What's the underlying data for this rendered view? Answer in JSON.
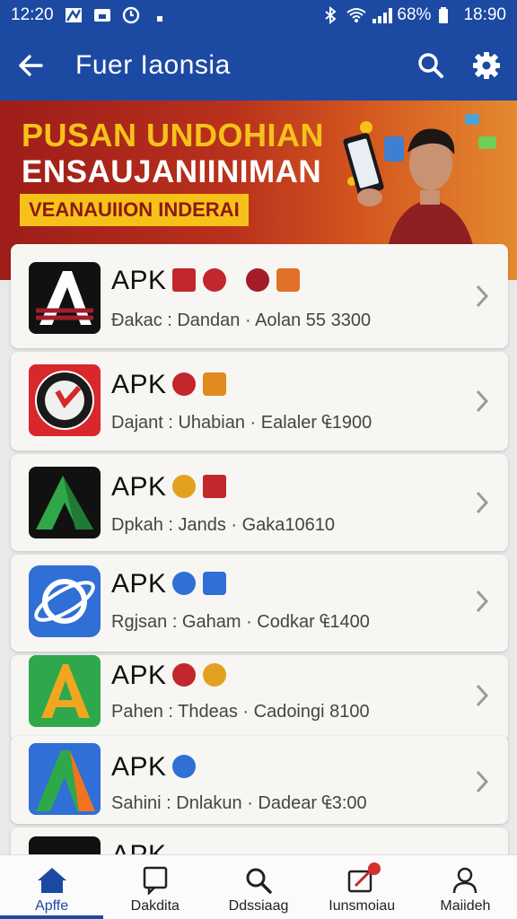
{
  "status": {
    "time": "12:20",
    "battery": "68%",
    "clock": "18:90"
  },
  "appbar": {
    "title": "Fuer Iaonsia"
  },
  "banner": {
    "line1": "PUSAN UNDOHIAN",
    "line2": "ENSAUJANIINIMAN",
    "line3": "VEANAUIION INDERAI"
  },
  "apps": [
    {
      "name": "APK",
      "meta": "Ðakac : Dandan  ·  Aolan 55 3300",
      "icon": "apk-a-black"
    },
    {
      "name": "APK",
      "meta": "Dajant :  Uhabian  ·  Ealaler ₠1900",
      "icon": "apk-red-badge"
    },
    {
      "name": "APK",
      "meta": "Dpkah : Jands    ·  Gaka10610",
      "icon": "apk-green-triangle"
    },
    {
      "name": "APK",
      "meta": "Rgjsan : Gaham  ·  Codkar ₠1400",
      "icon": "apk-blue-ie"
    },
    {
      "name": "APK",
      "meta": "Pahen : Thdeas  ·  Cadoingi 8100",
      "icon": "apk-green-a"
    },
    {
      "name": "APK",
      "meta": "Sahini : Dnlakun  ·  Dadear ₠3:00",
      "icon": "apk-blue-a"
    },
    {
      "name": "APK",
      "meta": "",
      "icon": "apk-partial"
    }
  ],
  "nav": [
    {
      "label": "Apffe",
      "icon": "home-icon"
    },
    {
      "label": "Dakdita",
      "icon": "chat-icon"
    },
    {
      "label": "Ddssiaag",
      "icon": "search-icon"
    },
    {
      "label": "Iunsmoiau",
      "icon": "edit-icon"
    },
    {
      "label": "Maiideh",
      "icon": "person-icon"
    }
  ],
  "colors": {
    "primary": "#1c4aa3",
    "banner_yellow": "#f6c21a",
    "banner_red": "#9e1d1a"
  }
}
